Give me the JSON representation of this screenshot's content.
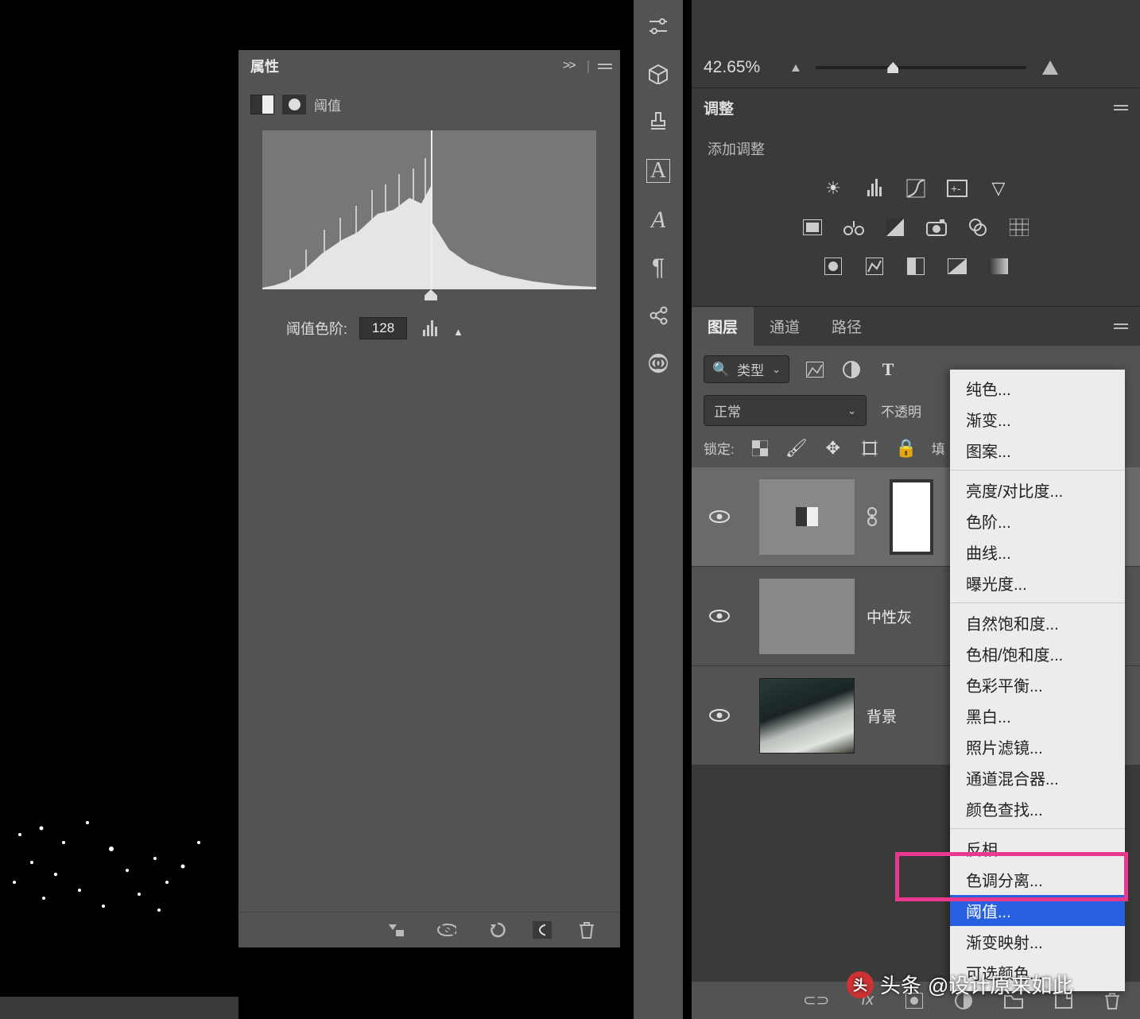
{
  "properties": {
    "title": "属性",
    "collapse_glyph": ">>",
    "adjustment_type": "阈值",
    "threshold_label": "阈值色阶:",
    "threshold_value": "128"
  },
  "navigator": {
    "zoom": "42.65%"
  },
  "adjustments": {
    "title": "调整",
    "add_label": "添加调整"
  },
  "layers_panel": {
    "tabs": {
      "layers": "图层",
      "channels": "通道",
      "paths": "路径"
    },
    "filter_label": "类型",
    "blend_mode": "正常",
    "opacity_label": "不透明",
    "lock_label": "锁定:",
    "fill_label": "填",
    "layers": [
      {
        "name": "",
        "type": "threshold"
      },
      {
        "name": "中性灰",
        "type": "gray"
      },
      {
        "name": "背景",
        "type": "photo"
      }
    ]
  },
  "context_menu": {
    "items": [
      "纯色...",
      "渐变...",
      "图案...",
      "亮度/对比度...",
      "色阶...",
      "曲线...",
      "曝光度...",
      "自然饱和度...",
      "色相/饱和度...",
      "色彩平衡...",
      "黑白...",
      "照片滤镜...",
      "通道混合器...",
      "颜色查找...",
      "反相",
      "色调分离...",
      "阈值...",
      "渐变映射...",
      "可选颜色..."
    ],
    "selected_index": 16,
    "separators_after": [
      2,
      6,
      13
    ]
  },
  "watermark": {
    "prefix": "头条",
    "text": "@设计原来如此"
  },
  "chart_data": {
    "type": "area",
    "title": "阈值",
    "xlim": [
      0,
      255
    ],
    "ylim": [
      0,
      100
    ],
    "threshold": 128,
    "x": [
      0,
      10,
      20,
      30,
      40,
      50,
      60,
      70,
      80,
      90,
      100,
      110,
      120,
      128,
      135,
      145,
      160,
      180,
      200,
      220,
      240,
      255
    ],
    "values": [
      2,
      4,
      8,
      15,
      25,
      35,
      42,
      55,
      58,
      65,
      62,
      68,
      75,
      100,
      45,
      30,
      22,
      12,
      8,
      5,
      3,
      2
    ]
  }
}
